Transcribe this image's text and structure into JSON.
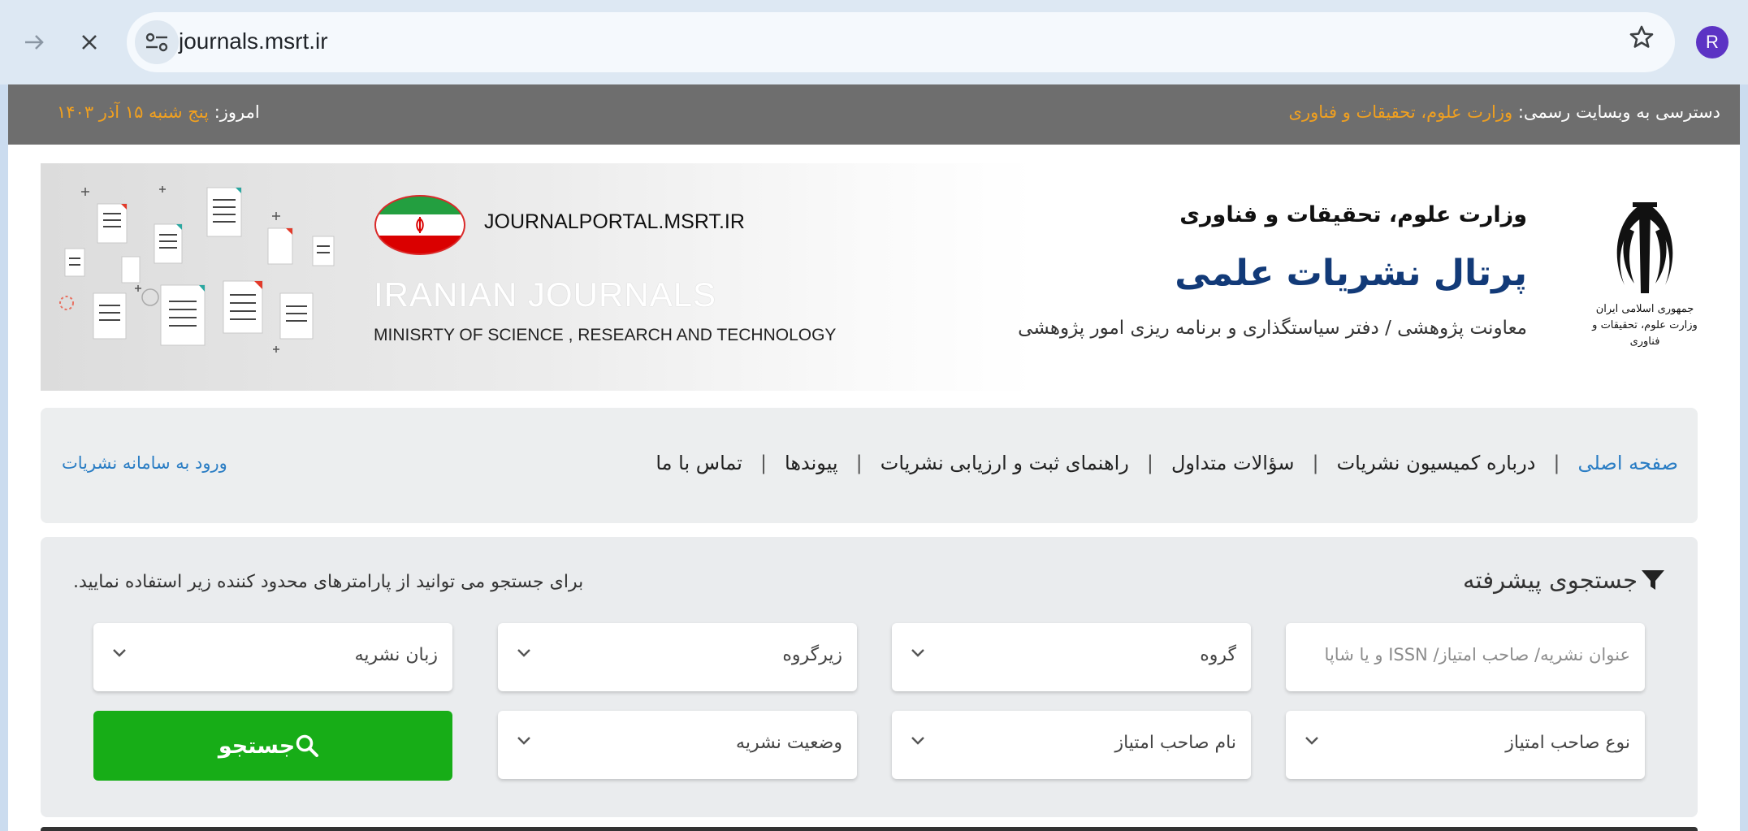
{
  "browser": {
    "url": "journals.msrt.ir",
    "avatar_letter": "R"
  },
  "topbar": {
    "access_label": "دسترسی به وبسایت رسمی:",
    "access_link": "وزارت علوم، تحقیقات و فناوری",
    "today_label": "امروز:",
    "today_date": "پنج شنبه ۱۵ آذر ۱۴۰۳"
  },
  "banner": {
    "emblem_line1": "جمهوری اسلامی ایران",
    "emblem_line2": "وزارت علوم، تحقیقات و فناوری",
    "ministry": "وزارت علوم، تحقیقات و فناوری",
    "portal": "پرتال نشریات علمی",
    "deputy": "معاونت پژوهشی / دفتر سیاستگذاری و برنامه ریزی امور پژوهشی",
    "portal_url": "JOURNALPORTAL.MSRT.IR",
    "en_title": "IRANIAN JOURNALS",
    "en_subtitle": "MINISRTY OF SCIENCE , RESEARCH AND TECHNOLOGY"
  },
  "nav": {
    "items": [
      "صفحه اصلی",
      "درباره کمیسیون نشریات",
      "سؤالات متداول",
      "راهنمای ثبت و ارزیابی نشریات",
      "پیوندها",
      "تماس با ما"
    ],
    "login": "ورود به سامانه نشریات"
  },
  "search": {
    "title": "جستجوی پیشرفته",
    "hint": "برای جستجو می توانید از پارامترهای محدود کننده زیر استفاده نمایید.",
    "title_field_placeholder": "عنوان نشریه/ صاحب امتیاز/ ISSN و یا شاپا",
    "group": "گروه",
    "subgroup": "زیرگروه",
    "language": "زبان نشریه",
    "owner_type": "نوع صاحب امتیاز",
    "owner_name": "نام صاحب امتیاز",
    "status": "وضعیت نشریه",
    "button": "جستجو"
  },
  "colors": {
    "topbar_bg": "#6e6e6e",
    "highlight": "#f0a020",
    "portal_title": "#123a78",
    "link": "#2a7dc4",
    "search_button": "#17ad17"
  }
}
